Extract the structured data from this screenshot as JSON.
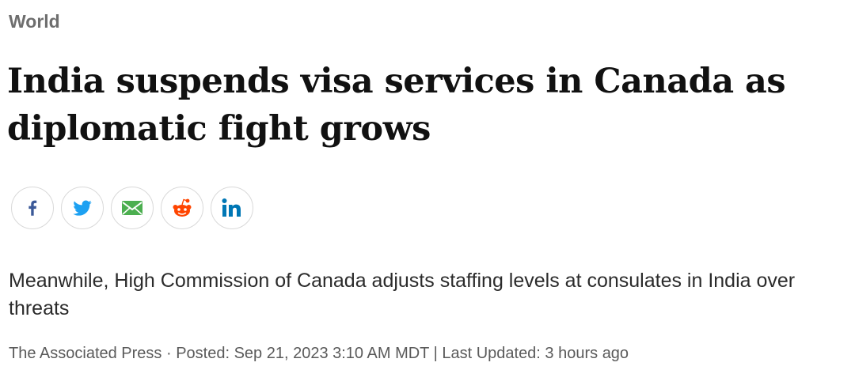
{
  "section": {
    "label": "World"
  },
  "headline": "India suspends visa services in Canada as diplomatic fight grows",
  "share": {
    "buttons": [
      {
        "icon": "facebook-icon",
        "color": "#3b5998"
      },
      {
        "icon": "twitter-icon",
        "color": "#1da1f2"
      },
      {
        "icon": "email-icon",
        "color": "#4caf50"
      },
      {
        "icon": "reddit-icon",
        "color": "#ff4500"
      },
      {
        "icon": "linkedin-icon",
        "color": "#0077b5"
      }
    ]
  },
  "deck": "Meanwhile, High Commission of Canada adjusts staffing levels at consulates in India over threats",
  "byline": {
    "text": "The Associated Press · Posted: Sep 21, 2023 3:10 AM MDT | Last Updated: 3 hours ago"
  },
  "colors": {
    "section_label": "#6e6e6e",
    "headline": "#111111",
    "deck": "#2b2b2b",
    "byline": "#5a5a5a",
    "button_border": "#d9d9d9"
  }
}
